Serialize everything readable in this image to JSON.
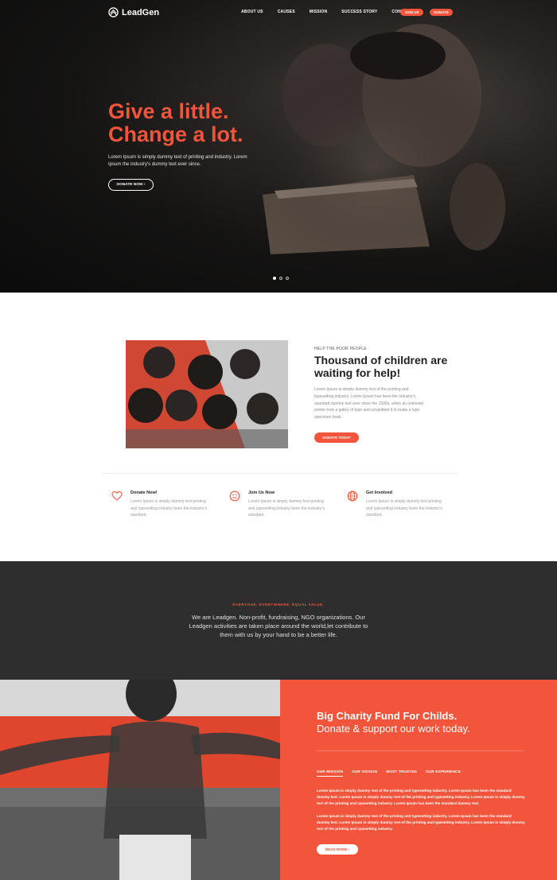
{
  "nav": {
    "logo": "LeadGen",
    "links": [
      "ABOUT US",
      "CAUSES",
      "MISSION",
      "SUCCESS STORY",
      "CONTACT"
    ],
    "join_label": "JOIN US",
    "donate_label": "DONATE"
  },
  "hero": {
    "title_line1": "Give a little.",
    "title_line2": "Change a lot.",
    "text": "Lorem Ipsum is simply dummy text of printing and industry. Lorem Ipsum the industry's dummy text ever since.",
    "button": "DONATE NOW  ›",
    "slides": 3,
    "active_slide": 0
  },
  "about": {
    "eyebrow": "HELP THE POOR PEOPLE",
    "title": "Thousand of children are waiting for help!",
    "text": "Lorem Ipsum is simply dummy text of the printing and typesetting industry. Lorem Ipsum has been the industry's standard dummy text ever since the 1500s, when an unknown printer took a galley of type and scrambled it to make a type specimen book.",
    "button": "DONATE TODAY"
  },
  "features": [
    {
      "icon": "heart-icon",
      "title": "Donate Now!",
      "text": "Lorem Ipsum is simply dummy text printing and typesetting industry been the industry's standard."
    },
    {
      "icon": "smiley-icon",
      "title": "Join Us Now",
      "text": "Lorem Ipsum is simply dummy text printing and typesetting industry been the industry's standard."
    },
    {
      "icon": "globe-icon",
      "title": "Get Involved",
      "text": "Lorem Ipsum is simply dummy text printing and typesetting industry been the industry's standard."
    }
  ],
  "mission": {
    "eyebrow": "EVERYONE. EVERYWHERE. EQUAL VALUE.",
    "text": "We are Leadgen. Non-profit, fundraising, NGO organizations. Our Leadgen activities are taken place around the world,let contribute to them with us by your hand to be a better life."
  },
  "charity": {
    "title": "Big Charity Fund For Childs.",
    "subtitle": "Donate & support our work today.",
    "tabs": [
      "OUR MISSION",
      "OUR VISSION",
      "MOST TRUSTED",
      "OUR EXPERIENCE"
    ],
    "active_tab": 0,
    "paragraph1": "Lorem Ipsum is simply dummy text of the printing and typesetting industry. Lorem Ipsum has been the standard dummy text. Lorem Ipsum is simply dummy text of the printing and typesetting industry. Lorem Ipsum is simply dummy text of the printing and typesetting industry. Lorem Ipsum has been the standard dummy text.",
    "paragraph2": "Lorem Ipsum is simply dummy text of the printing and typesetting industry. Lorem Ipsum has been the standard dummy text. Lorem Ipsum is simply dummy text of the printing and typesetting industry. Lorem Ipsum is simply dummy text of the printing and typesetting industry.",
    "button": "READ MORE  ›"
  },
  "colors": {
    "accent": "#f2553b",
    "dark_band": "#2e2e2e",
    "hero_bg": "#0b0b0b"
  }
}
